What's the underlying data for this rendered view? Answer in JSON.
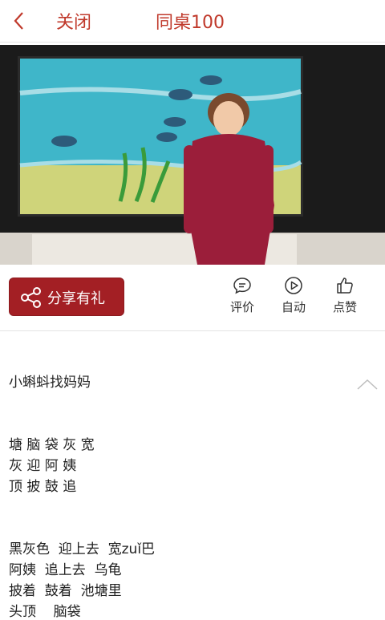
{
  "header": {
    "back_icon": "chevron-left-icon",
    "close_label": "关闭",
    "title": "同桌100"
  },
  "actions": {
    "share_label": "分享有礼",
    "share_icon": "share-icon",
    "comment_label": "评价",
    "autoplay_label": "自动",
    "like_label": "点赞"
  },
  "lesson": {
    "title": "小蝌蚪找妈妈",
    "chars": [
      "塘 脑 袋 灰 宽",
      "灰 迎 阿 姨",
      "顶 披 鼓 追"
    ],
    "words": [
      "黑灰色  迎上去  宽zuǐ巴",
      "阿姨  追上去  乌龟",
      "披着  鼓着  池塘里",
      "头顶    脑袋"
    ]
  },
  "colors": {
    "accent": "#c0392b",
    "share_button": "#a31f24"
  }
}
